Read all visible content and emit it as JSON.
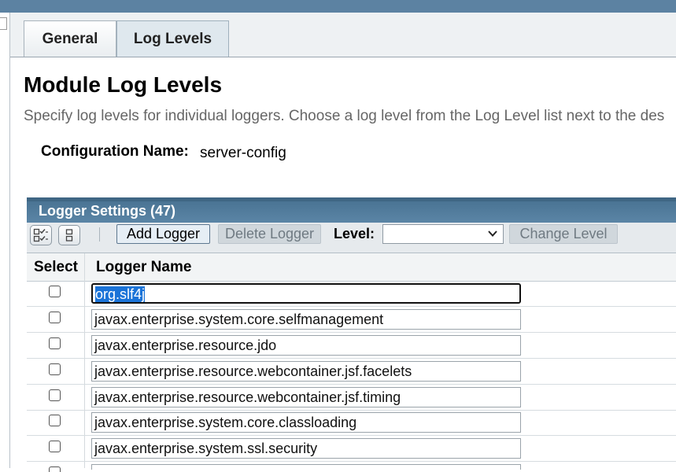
{
  "tabs": [
    {
      "label": "General"
    },
    {
      "label": "Log Levels"
    }
  ],
  "page": {
    "title": "Module Log Levels",
    "description": "Specify log levels for individual loggers. Choose a log level from the Log Level list next to the des"
  },
  "config": {
    "label": "Configuration Name:",
    "value": "server-config"
  },
  "table": {
    "title": "Logger Settings (47)",
    "toolbar": {
      "add_label": "Add Logger",
      "delete_label": "Delete Logger",
      "level_label": "Level:",
      "level_value": "",
      "change_label": "Change Level"
    },
    "columns": {
      "select": "Select",
      "name": "Logger Name"
    },
    "rows": [
      {
        "name": "org.slf4j"
      },
      {
        "name": "javax.enterprise.system.core.selfmanagement"
      },
      {
        "name": "javax.enterprise.resource.jdo"
      },
      {
        "name": "javax.enterprise.resource.webcontainer.jsf.facelets"
      },
      {
        "name": "javax.enterprise.resource.webcontainer.jsf.timing"
      },
      {
        "name": "javax.enterprise.system.core.classloading"
      },
      {
        "name": "javax.enterprise.system.ssl.security"
      }
    ]
  },
  "colors": {
    "header_blue": "#5b85a6",
    "selection_blue": "#1a73d8"
  },
  "icons": {
    "select_all": "select-all-icon",
    "deselect_all": "deselect-all-icon",
    "dropdown": "chevron-down-icon"
  }
}
